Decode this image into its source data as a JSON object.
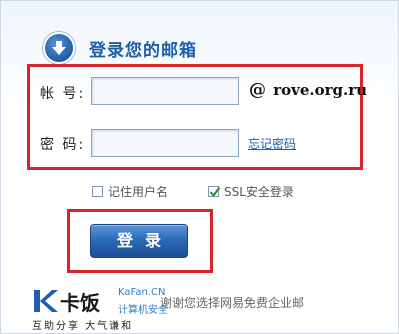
{
  "header": {
    "title": "登录您的邮箱"
  },
  "form": {
    "account_label": "帐 号:",
    "account_value": "",
    "account_domain_at": "@",
    "account_domain": "rove.org.ru",
    "password_label": "密 码:",
    "password_value": "",
    "forgot_password": "忘记密码",
    "remember_label": "记住用户名",
    "remember_checked": false,
    "ssl_label": "SSL安全登录",
    "ssl_checked": true,
    "login_button": "登录"
  },
  "footer": {
    "note": "谢谢您选择网易免费企业邮"
  },
  "watermark": {
    "name": "卡饭",
    "site": "KaFan.CN",
    "tagline": "计算机安全",
    "slogan": "互助分享  大气谦和"
  },
  "colors": {
    "accent": "#1f5ea8",
    "highlight": "#d6262c",
    "check": "#2e8b2e"
  }
}
